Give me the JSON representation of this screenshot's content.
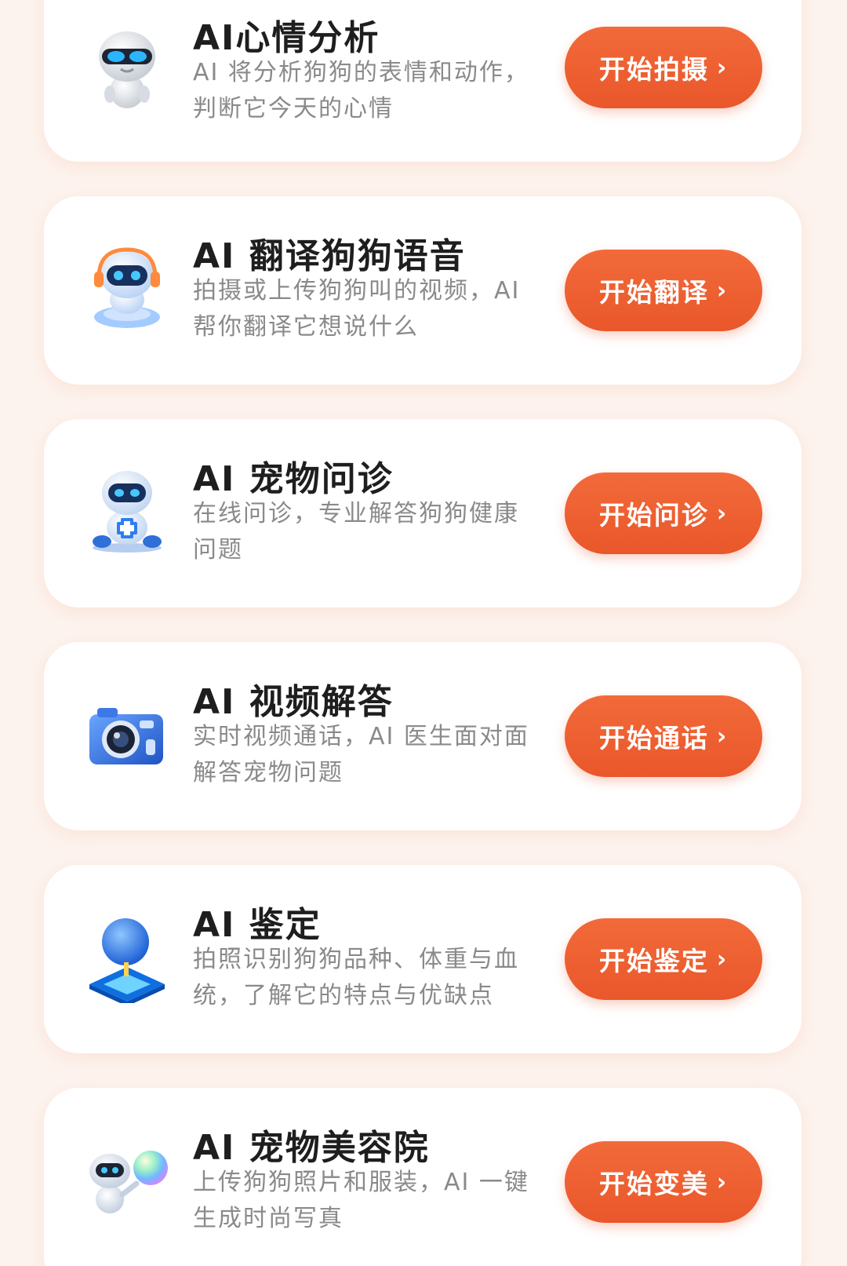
{
  "cards": [
    {
      "title": "AI心情分析",
      "desc": "AI 将分析狗狗的表情和动作，判断它今天的心情",
      "button": "开始拍摄",
      "chevron": "›",
      "icon": "robot-sunglasses-icon"
    },
    {
      "title": "AI 翻译狗狗语音",
      "desc": "拍摄或上传狗狗叫的视频，AI 帮你翻译它想说什么",
      "button": "开始翻译",
      "chevron": "›",
      "icon": "robot-headset-icon"
    },
    {
      "title": "AI 宠物问诊",
      "desc": "在线问诊，专业解答狗狗健康问题",
      "button": "开始问诊",
      "chevron": "›",
      "icon": "robot-doctor-icon"
    },
    {
      "title": "AI 视频解答",
      "desc": "实时视频通话，AI 医生面对面解答宠物问题",
      "button": "开始通话",
      "chevron": "›",
      "icon": "camera-icon"
    },
    {
      "title": "AI 鉴定",
      "desc": "拍照识别狗狗品种、体重与血统，了解它的特点与优缺点",
      "button": "开始鉴定",
      "chevron": "›",
      "icon": "ai-chip-icon"
    },
    {
      "title": "AI 宠物美容院",
      "desc": "上传狗狗照片和服装，AI 一键生成时尚写真",
      "button": "开始变美",
      "chevron": "›",
      "icon": "robot-bubble-icon"
    }
  ],
  "colors": {
    "background": "#fdf3ee",
    "button": "#ee5f30",
    "title": "#1e1e1e",
    "description": "#8a8a8a"
  }
}
